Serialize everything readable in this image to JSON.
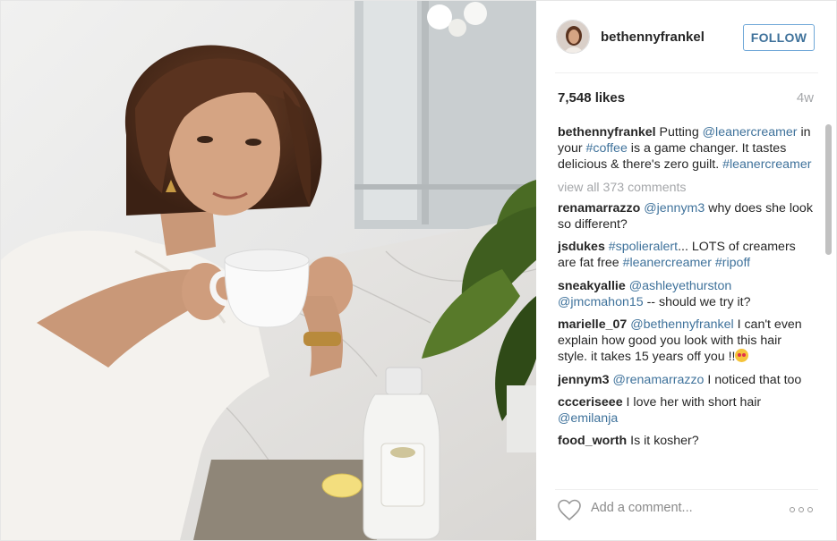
{
  "post": {
    "username": "bethennyfrankel",
    "follow_label": "FOLLOW",
    "likes": "7,548 likes",
    "age": "4w",
    "caption": {
      "user": "bethennyfrankel",
      "t1": " Putting ",
      "mention": "@leanercreamer",
      "t2": " in your ",
      "tag1": "#coffee",
      "t3": " is a game changer. It tastes delicious & there's zero guilt. ",
      "tag2": "#leanercreamer"
    },
    "view_all": "view all 373 comments",
    "comments": [
      {
        "user": "renamarrazzo",
        "link": "@jennym3",
        "text": " why does she look so different?"
      },
      {
        "user": "jsdukes",
        "link": "#spolieralert",
        "text": "... LOTS of creamers are fat free ",
        "link2": "#leanercreamer",
        "text2": " ",
        "link3": "#ripoff"
      },
      {
        "user": "sneakyallie",
        "link": "@ashleyethurston",
        "text": " ",
        "link2": "@jmcmahon15",
        "text2": " -- should we try it?"
      },
      {
        "user": "marielle_07",
        "link": "@bethennyfrankel",
        "text": " I can't even explain how good you look with this hair style. it takes 15 years off you !!"
      },
      {
        "user": "jennym3",
        "link": "@renamarrazzo",
        "text": " I noticed that too"
      },
      {
        "user": "ccceriseee",
        "text": " I love her with short hair ",
        "link": "@emilanja"
      },
      {
        "user": "food_worth",
        "text": " Is it kosher?"
      }
    ],
    "comment_placeholder": "Add a comment...",
    "icons": {
      "like": "heart-icon",
      "more": "more-options-icon"
    },
    "colors": {
      "link": "#3f729b",
      "follow_border": "#70a8d8",
      "muted": "#a5a7aa"
    }
  }
}
